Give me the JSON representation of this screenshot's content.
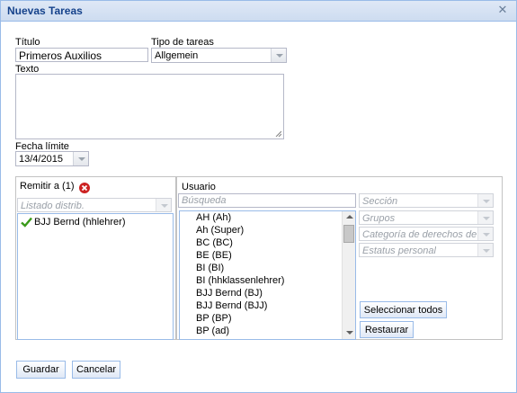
{
  "window": {
    "title": "Nuevas Tareas"
  },
  "form": {
    "titulo_label": "Título",
    "titulo_value": "Primeros Auxilios",
    "tipo_label": "Tipo de tareas",
    "tipo_value": "Allgemein",
    "texto_label": "Texto",
    "texto_value": "",
    "fecha_label": "Fecha límite",
    "fecha_value": "13/4/2015"
  },
  "remitir": {
    "header": "Remitir a (1)",
    "distrib_placeholder": "Listado distrib.",
    "recipients": [
      "BJJ Bernd (hhlehrer)"
    ]
  },
  "usuario": {
    "header": "Usuario",
    "search_placeholder": "Búsqueda",
    "users": [
      "AH (Ah)",
      "Ah (Super)",
      "BC (BC)",
      "BE (BE)",
      "BI (BI)",
      "BI (hhklassenlehrer)",
      "BJJ Bernd (BJ)",
      "BJJ Bernd (BJJ)",
      "BP (BP)",
      "BP (ad)"
    ],
    "filters": [
      "Sección",
      "Grupos",
      "Categoría de derechos de u",
      "Estatus personal"
    ],
    "select_all_label": "Seleccionar todos",
    "restore_label": "Restaurar"
  },
  "footer": {
    "save_label": "Guardar",
    "cancel_label": "Cancelar"
  },
  "colors": {
    "title_text": "#15428b",
    "border": "#99bbe8",
    "remove_icon": "#cc2222",
    "check_icon": "#3a9a1a"
  }
}
